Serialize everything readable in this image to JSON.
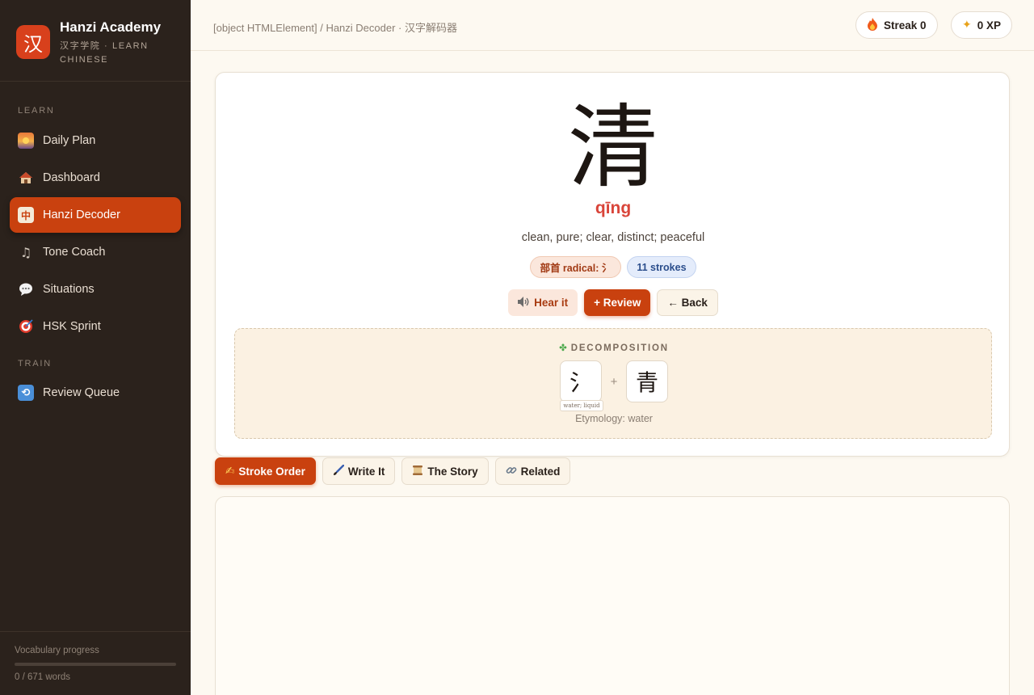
{
  "app": {
    "logo_glyph": "汉",
    "title": "Hanzi Academy",
    "subtitle": "汉字学院 · LEARN CHINESE"
  },
  "sidebar": {
    "sections": [
      {
        "label": "LEARN",
        "items": [
          {
            "label": "Daily Plan",
            "icon": "sunrise-icon",
            "active": false
          },
          {
            "label": "Dashboard",
            "icon": "house-icon",
            "active": false
          },
          {
            "label": "Hanzi Decoder",
            "icon": "mahjong-tile-icon",
            "active": true
          },
          {
            "label": "Tone Coach",
            "icon": "music-note-icon",
            "active": false
          },
          {
            "label": "Situations",
            "icon": "speech-bubble-icon",
            "active": false
          },
          {
            "label": "HSK Sprint",
            "icon": "target-icon",
            "active": false
          }
        ]
      },
      {
        "label": "TRAIN",
        "items": [
          {
            "label": "Review Queue",
            "icon": "repeat-icon",
            "active": false
          }
        ]
      }
    ],
    "progress": {
      "label": "Vocabulary progress",
      "count_text": "0 / 671 words",
      "fraction": 0
    }
  },
  "header": {
    "breadcrumb": "[object HTMLElement] / Hanzi Decoder · 汉字解码器",
    "streak": {
      "icon": "fire-icon",
      "text": "Streak 0"
    },
    "xp": {
      "icon": "sparkle-icon",
      "text": "0 XP"
    }
  },
  "character": {
    "hanzi": "清",
    "pinyin": "qīng",
    "meaning": "clean, pure; clear, distinct; peaceful",
    "radical_chip": "部首 radical: 氵",
    "strokes_chip": "11 strokes",
    "actions": {
      "hear": "Hear it",
      "review": "+ Review",
      "back": "← Back"
    },
    "decomposition": {
      "title": "DECOMPOSITION",
      "components": [
        {
          "glyph": "氵",
          "gloss": "water; liquid"
        },
        {
          "glyph": "青",
          "gloss": ""
        }
      ],
      "separator": "+",
      "etymology": "Etymology: water"
    }
  },
  "tabs": [
    {
      "label": "Stroke Order",
      "icon": "writing-hand-icon",
      "active": true
    },
    {
      "label": "Write It",
      "icon": "paintbrush-icon",
      "active": false
    },
    {
      "label": "The Story",
      "icon": "scroll-icon",
      "active": false
    },
    {
      "label": "Related",
      "icon": "link-icon",
      "active": false
    }
  ],
  "colors": {
    "accent": "#c9410f",
    "sidebar_bg": "#2b221c",
    "pinyin": "#d9453a",
    "page_bg": "#fdf9f1"
  }
}
